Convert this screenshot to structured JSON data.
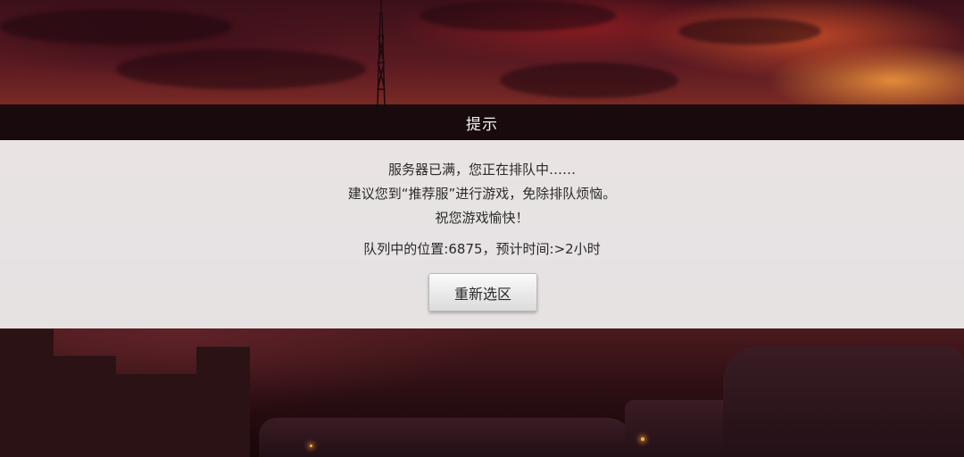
{
  "dialog": {
    "title": "提示",
    "message_lines": [
      "服务器已满，您正在排队中……",
      "建议您到“推荐服”进行游戏，免除排队烦恼。",
      "祝您游戏愉快！"
    ],
    "queue_info": "队列中的位置:6875，预计时间:>2小时",
    "button_label": "重新选区"
  },
  "colors": {
    "header_bg": "#120a0c",
    "body_bg": "#f2f0f0",
    "text": "#2a2a2a",
    "accent_sky": "#c8502a"
  }
}
